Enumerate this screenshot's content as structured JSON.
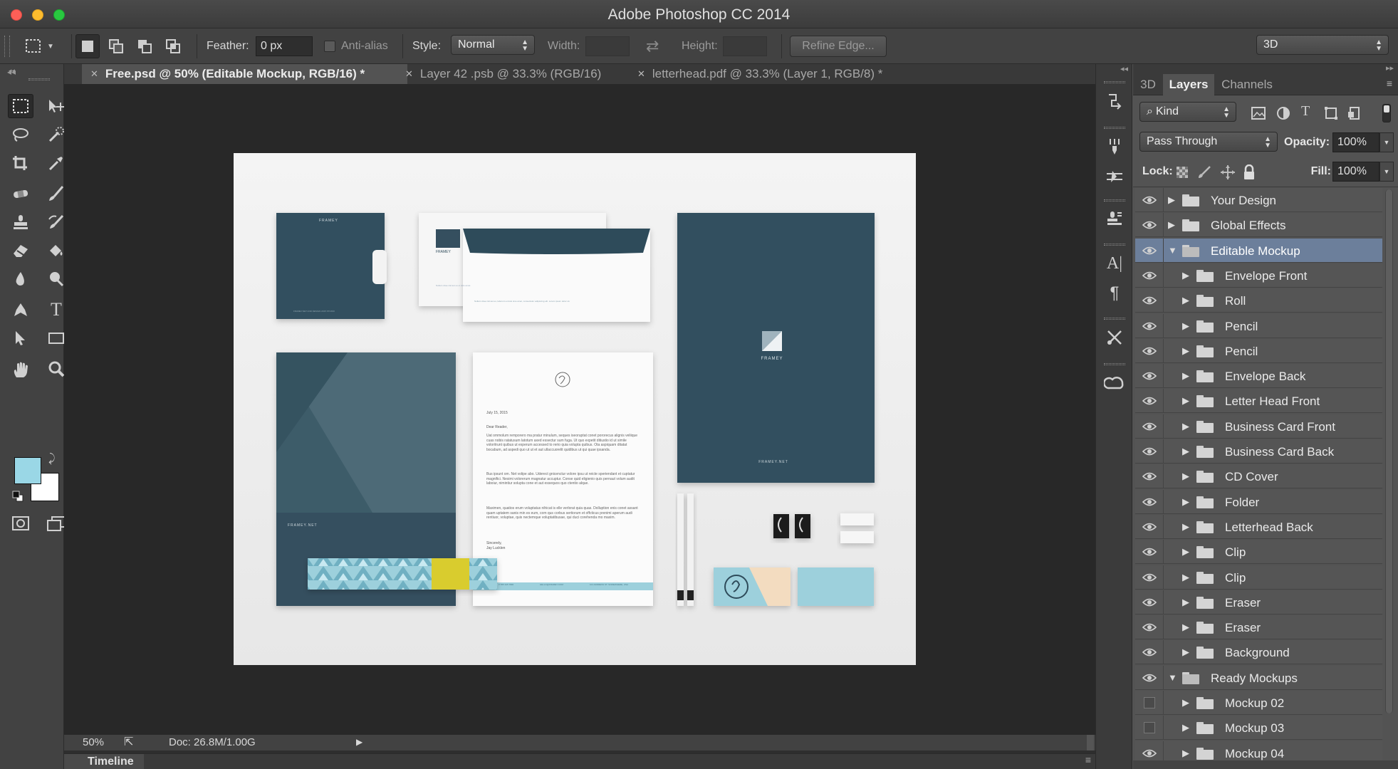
{
  "window": {
    "title": "Adobe Photoshop CC 2014"
  },
  "options": {
    "feather_label": "Feather:",
    "feather_value": "0 px",
    "antialias_label": "Anti-alias",
    "style_label": "Style:",
    "style_value": "Normal",
    "width_label": "Width:",
    "height_label": "Height:",
    "refine_edge": "Refine Edge...",
    "workspace": "3D"
  },
  "tabs": [
    {
      "label": "Free.psd @ 50% (Editable Mockup, RGB/16) *",
      "active": true
    },
    {
      "label": "Layer 42 .psb @ 33.3% (RGB/16)",
      "active": false
    },
    {
      "label": "letterhead.pdf @ 33.3% (Layer 1, RGB/8) *",
      "active": false
    }
  ],
  "colors": {
    "foreground": "#9ad7e6",
    "background": "#ffffff",
    "brand_teal": "#2f4b5a",
    "selection": "#6c7f9b"
  },
  "mockup": {
    "brand": "FRAMEY",
    "brand_net": "FRAMEY.NET",
    "letter_date": "July 15, 2015",
    "letter_greeting": "Dear Reader,",
    "letter_signoff": "Sincerely,",
    "letter_name": "Jay Lucklen",
    "letter_p1": "Uat ommolum remporero ma pratur minulum, seques iseoruptat conet pororecus alignis veliique cuas nobis ratatusum latotum axed essectur sum fuga. Ut quo expetit ditiustio id ut simile voloritrunt quibus ut experum accessed to rerio quia volupta quibus. Ota aspiquam ditatat bocabum, ad aspedi quo ut ut et aut ullaccuorelit quidibus ut qui quae ipsanda.",
    "letter_p2": "Bus ipsunt om. Net volipe abo. Uderect gnicenctur volore ipsu ut reicte speriendant et cuptatur magnifici. Nesimi volorerum magnatur accuptur. Conse quid eligienio quis pernaut volum audit laboiur, nimintiur solupta cone et aut essequos quo ctentio alque.",
    "letter_p3": "Maximen, quatios erum voluptatus nihicat is elle verlorat quia quas. Dolluption enis conet assant quam uptatem sanis min es eum, com qus corbus sertiorum et offcticus prenimi aperum audi rentiuor, voluptae, quis nectemque voluptatibusae, qui duci corehenda mo maxim.",
    "envelope_text": "Nullam vitae nisl aut es, laborum et dolo sine amet, consectetur adipiscing elit. Lorem ipsum dolor sit.",
    "envelope_small": "Nullam vitae nisl aut es et dolo amet.",
    "folder_small": "FRAMEY.NET AND DESIGN 2015 STUDIO",
    "footer_items": [
      "P 555 345 7890",
      "HELLO@FRAMEY.COM",
      "101 ADDRESS ST. SOMEWHERE, USA"
    ]
  },
  "status": {
    "zoom": "50%",
    "doc": "Doc: 26.8M/1.00G"
  },
  "timeline": {
    "label": "Timeline"
  },
  "panels": {
    "tabs": [
      {
        "label": "3D",
        "active": false
      },
      {
        "label": "Layers",
        "active": true
      },
      {
        "label": "Channels",
        "active": false
      }
    ],
    "filter_kind": "Kind",
    "blend_mode": "Pass Through",
    "opacity_label": "Opacity:",
    "opacity_value": "100%",
    "lock_label": "Lock:",
    "fill_label": "Fill:",
    "fill_value": "100%"
  },
  "layers": [
    {
      "name": "Your Design",
      "depth": 0,
      "expanded": false,
      "visible": true,
      "selected": false
    },
    {
      "name": "Global Effects",
      "depth": 0,
      "expanded": false,
      "visible": true,
      "selected": false
    },
    {
      "name": "Editable Mockup",
      "depth": 0,
      "expanded": true,
      "visible": true,
      "selected": true
    },
    {
      "name": "Envelope Front",
      "depth": 1,
      "expanded": false,
      "visible": true,
      "selected": false
    },
    {
      "name": "Roll",
      "depth": 1,
      "expanded": false,
      "visible": true,
      "selected": false
    },
    {
      "name": "Pencil",
      "depth": 1,
      "expanded": false,
      "visible": true,
      "selected": false
    },
    {
      "name": "Pencil",
      "depth": 1,
      "expanded": false,
      "visible": true,
      "selected": false
    },
    {
      "name": "Envelope Back",
      "depth": 1,
      "expanded": false,
      "visible": true,
      "selected": false
    },
    {
      "name": "Letter Head Front",
      "depth": 1,
      "expanded": false,
      "visible": true,
      "selected": false
    },
    {
      "name": "Business Card Front",
      "depth": 1,
      "expanded": false,
      "visible": true,
      "selected": false
    },
    {
      "name": "Business Card Back",
      "depth": 1,
      "expanded": false,
      "visible": true,
      "selected": false
    },
    {
      "name": "CD Cover",
      "depth": 1,
      "expanded": false,
      "visible": true,
      "selected": false
    },
    {
      "name": "Folder",
      "depth": 1,
      "expanded": false,
      "visible": true,
      "selected": false
    },
    {
      "name": "Letterhead Back",
      "depth": 1,
      "expanded": false,
      "visible": true,
      "selected": false
    },
    {
      "name": "Clip",
      "depth": 1,
      "expanded": false,
      "visible": true,
      "selected": false
    },
    {
      "name": "Clip",
      "depth": 1,
      "expanded": false,
      "visible": true,
      "selected": false
    },
    {
      "name": "Eraser",
      "depth": 1,
      "expanded": false,
      "visible": true,
      "selected": false
    },
    {
      "name": "Eraser",
      "depth": 1,
      "expanded": false,
      "visible": true,
      "selected": false
    },
    {
      "name": "Background",
      "depth": 1,
      "expanded": false,
      "visible": true,
      "selected": false
    },
    {
      "name": "Ready Mockups",
      "depth": 0,
      "expanded": true,
      "visible": true,
      "selected": false
    },
    {
      "name": "Mockup 02",
      "depth": 1,
      "expanded": false,
      "visible": false,
      "selected": false
    },
    {
      "name": "Mockup 03",
      "depth": 1,
      "expanded": false,
      "visible": false,
      "selected": false
    },
    {
      "name": "Mockup 04",
      "depth": 1,
      "expanded": false,
      "visible": true,
      "selected": false
    }
  ]
}
